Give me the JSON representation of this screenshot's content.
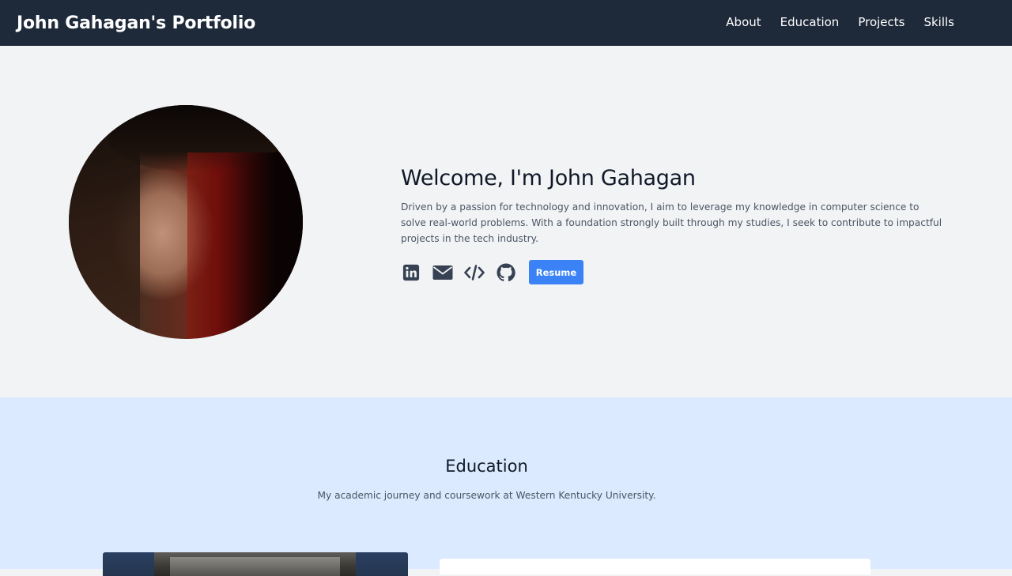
{
  "navbar": {
    "brand": "John Gahagan's Portfolio",
    "links": [
      {
        "label": "About"
      },
      {
        "label": "Education"
      },
      {
        "label": "Projects"
      },
      {
        "label": "Skills"
      }
    ]
  },
  "hero": {
    "title": "Welcome, I'm John Gahagan",
    "description": "Driven by a passion for technology and innovation, I aim to leverage my knowledge in computer science to solve real-world problems. With a foundation strongly built through my studies, I seek to contribute to impactful projects in the tech industry.",
    "social_icons": [
      "linkedin-icon",
      "email-icon",
      "code-icon",
      "github-icon"
    ],
    "resume_label": "Resume"
  },
  "education": {
    "title": "Education",
    "subtitle": "My academic journey and coursework at Western Kentucky University."
  },
  "colors": {
    "navbar_bg": "#1e2939",
    "hero_bg": "#f2f3f5",
    "education_bg": "#dbeafe",
    "accent": "#3b82f6",
    "icon": "#364153"
  }
}
